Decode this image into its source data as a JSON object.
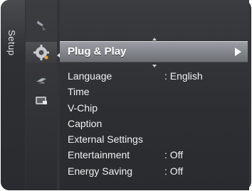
{
  "side_tab": {
    "label": "Setup"
  },
  "icons": [
    {
      "name": "picture-icon"
    },
    {
      "name": "sound-icon"
    },
    {
      "name": "setup-gear-icon"
    },
    {
      "name": "input-icon"
    },
    {
      "name": "application-icon"
    }
  ],
  "selected": {
    "label": "Plug & Play",
    "arrow": "►"
  },
  "menu": {
    "items": [
      {
        "label": "Language",
        "value": ": English"
      },
      {
        "label": "Time",
        "value": ""
      },
      {
        "label": "V-Chip",
        "value": ""
      },
      {
        "label": "Caption",
        "value": ""
      },
      {
        "label": "External Settings",
        "value": ""
      },
      {
        "label": "Entertainment",
        "value": ": Off"
      },
      {
        "label": "Energy Saving",
        "value": ": Off"
      }
    ]
  }
}
